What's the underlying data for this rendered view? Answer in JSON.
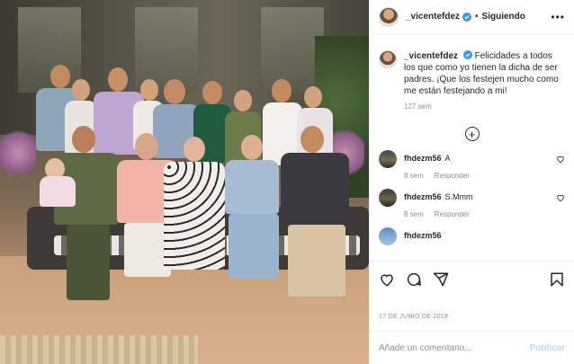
{
  "header": {
    "username": "_vicentefdez",
    "separator": "•",
    "follow_label": "Siguiendo",
    "more_label": "•••"
  },
  "caption": {
    "username": "_vicentefdez",
    "text": "Felicidades a todos los que como yo tienen la dicha de ser padres. ¡Que los festejen mucho como me están festejando a mi!",
    "time": "127 sem"
  },
  "load_more_label": "+",
  "comments": [
    {
      "username": "fhdezm56",
      "text": "A",
      "time": "8 sem",
      "reply": "Responder"
    },
    {
      "username": "fhdezm56",
      "text": "S.Mmm",
      "time": "8 sem",
      "reply": "Responder"
    },
    {
      "username": "fhdezm56",
      "text": "",
      "time": "",
      "reply": ""
    }
  ],
  "post_date": "17 DE JUNIO DE 2018",
  "comment_input": {
    "placeholder": "Añade un comentario...",
    "value": ""
  },
  "publish_label": "Publicar",
  "icons": [
    "verified-badge-icon",
    "heart-icon",
    "comment-icon",
    "share-icon",
    "bookmark-icon",
    "plus-circle-icon"
  ],
  "colors": {
    "verified": "#3897f0",
    "publish": "#b3dbff",
    "secondary_text": "#8e8e8e"
  }
}
